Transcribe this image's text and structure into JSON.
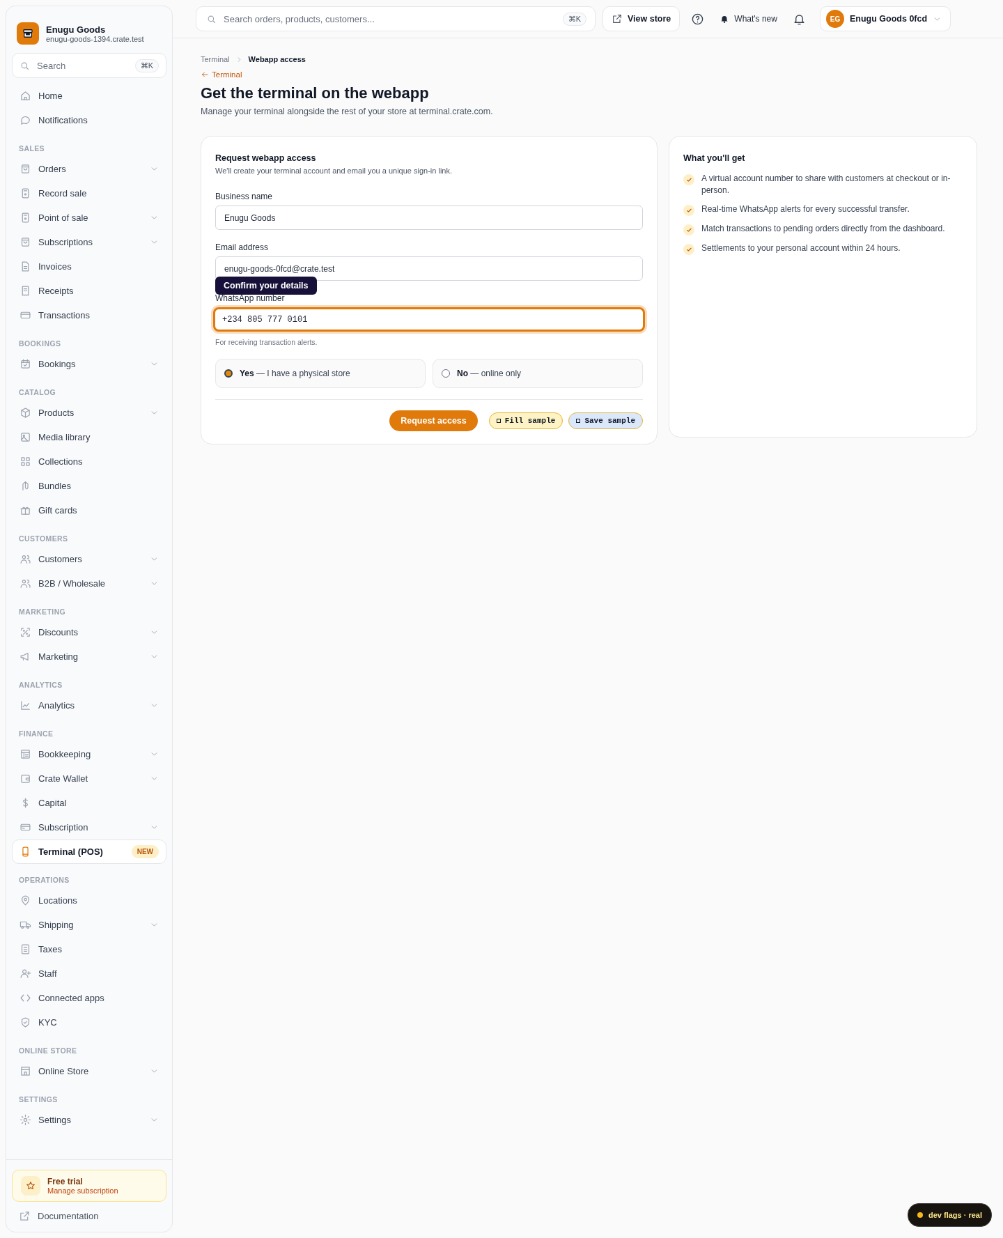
{
  "store": {
    "name": "Enugu Goods",
    "domain": "enugu-goods-1394.crate.test"
  },
  "sidebar": {
    "search": {
      "placeholder": "Search",
      "shortcut": "⌘K"
    },
    "sections": [
      {
        "items": [
          {
            "label": "Home",
            "has_submenu": false,
            "selected": false
          },
          {
            "label": "Notifications",
            "has_submenu": false,
            "selected": false
          }
        ]
      },
      {
        "heading": "SALES",
        "items": [
          {
            "label": "Orders",
            "has_submenu": true,
            "selected": false
          },
          {
            "label": "Record sale",
            "has_submenu": false,
            "selected": false
          },
          {
            "label": "Point of sale",
            "has_submenu": true,
            "selected": false
          },
          {
            "label": "Subscriptions",
            "has_submenu": true,
            "selected": false
          },
          {
            "label": "Invoices",
            "has_submenu": false,
            "selected": false
          },
          {
            "label": "Receipts",
            "has_submenu": false,
            "selected": false
          },
          {
            "label": "Transactions",
            "has_submenu": false,
            "selected": false
          }
        ]
      },
      {
        "heading": "BOOKINGS",
        "items": [
          {
            "label": "Bookings",
            "has_submenu": true,
            "selected": false
          }
        ]
      },
      {
        "heading": "CATALOG",
        "items": [
          {
            "label": "Products",
            "has_submenu": true,
            "selected": false
          },
          {
            "label": "Media library",
            "has_submenu": false,
            "selected": false
          },
          {
            "label": "Collections",
            "has_submenu": false,
            "selected": false
          },
          {
            "label": "Bundles",
            "has_submenu": false,
            "selected": false
          },
          {
            "label": "Gift cards",
            "has_submenu": false,
            "selected": false
          }
        ]
      },
      {
        "heading": "CUSTOMERS",
        "items": [
          {
            "label": "Customers",
            "has_submenu": true,
            "selected": false
          },
          {
            "label": "B2B / Wholesale",
            "has_submenu": true,
            "selected": false
          }
        ]
      },
      {
        "heading": "MARKETING",
        "items": [
          {
            "label": "Discounts",
            "has_submenu": true,
            "selected": false
          },
          {
            "label": "Marketing",
            "has_submenu": true,
            "selected": false
          }
        ]
      },
      {
        "heading": "ANALYTICS",
        "items": [
          {
            "label": "Analytics",
            "has_submenu": true,
            "selected": false
          }
        ]
      },
      {
        "heading": "FINANCE",
        "items": [
          {
            "label": "Bookkeeping",
            "has_submenu": true,
            "selected": false
          },
          {
            "label": "Crate Wallet",
            "has_submenu": true,
            "selected": false
          },
          {
            "label": "Capital",
            "has_submenu": false,
            "selected": false
          },
          {
            "label": "Subscription",
            "has_submenu": true,
            "selected": false
          },
          {
            "label": "Terminal (POS)",
            "has_submenu": false,
            "selected": true,
            "badge": "NEW"
          }
        ]
      },
      {
        "heading": "OPERATIONS",
        "items": [
          {
            "label": "Locations",
            "has_submenu": false,
            "selected": false
          },
          {
            "label": "Shipping",
            "has_submenu": true,
            "selected": false
          },
          {
            "label": "Taxes",
            "has_submenu": false,
            "selected": false
          },
          {
            "label": "Staff",
            "has_submenu": false,
            "selected": false
          },
          {
            "label": "Connected apps",
            "has_submenu": false,
            "selected": false
          },
          {
            "label": "KYC",
            "has_submenu": false,
            "selected": false
          }
        ]
      },
      {
        "heading": "ONLINE STORE",
        "items": [
          {
            "label": "Online Store",
            "has_submenu": true,
            "selected": false
          }
        ]
      },
      {
        "heading": "SETTINGS",
        "items": [
          {
            "label": "Settings",
            "has_submenu": true,
            "selected": false
          }
        ]
      }
    ],
    "trial": {
      "title": "Free trial",
      "link": "Manage subscription"
    },
    "documentation": "Documentation"
  },
  "topbar": {
    "search": {
      "placeholder": "Search orders, products, customers...",
      "shortcut": "⌘K"
    },
    "view_store": "View store",
    "whats_new": "What's new",
    "account": {
      "initials": "EG",
      "name": "Enugu Goods 0fcd"
    }
  },
  "breadcrumb": [
    {
      "label": "Terminal",
      "selected": false
    },
    {
      "label": "Webapp access",
      "selected": true
    }
  ],
  "back_link": "Terminal",
  "title": "Get the terminal on the webapp",
  "subtitle": "Manage your terminal alongside the rest of your store at terminal.crate.com.",
  "form": {
    "title": "Request webapp access",
    "subtitle": "We'll create your terminal account and email you a unique sign-in link.",
    "fields": [
      {
        "label": "Business name",
        "value": "Enugu Goods",
        "focused": false,
        "mono": false
      },
      {
        "label": "Email address",
        "value": "enugu-goods-0fcd@crate.test",
        "focused": false,
        "mono": false
      },
      {
        "label": "WhatsApp number",
        "value": "+234 805 777 0101",
        "focused": true,
        "mono": true,
        "help": "For receiving transaction alerts."
      }
    ],
    "tooltip": "Confirm your details",
    "options": [
      {
        "bold": "Yes",
        "rest": " — I have a physical store",
        "selected": true
      },
      {
        "bold": "No",
        "rest": " — online only",
        "selected": false
      }
    ],
    "submit": "Request access",
    "dev_buttons": [
      {
        "label": "Fill sample",
        "color": "#fdf3c4"
      },
      {
        "label": "Save sample",
        "color": "#dbe8fb"
      }
    ]
  },
  "benefits": {
    "title": "What you'll get",
    "items": [
      "A virtual account number to share with customers at checkout or in-person.",
      "Real-time WhatsApp alerts for every successful transfer.",
      "Match transactions to pending orders directly from the dashboard.",
      "Settlements to your personal account within 24 hours."
    ]
  },
  "dev_flags": "dev flags · real"
}
